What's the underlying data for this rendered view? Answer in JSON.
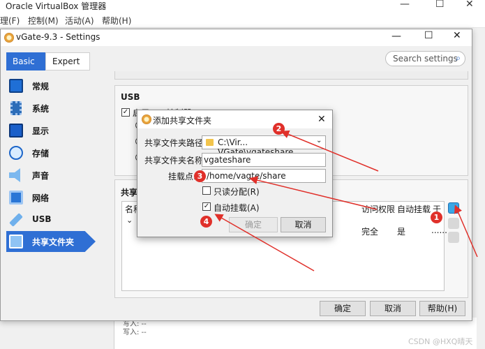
{
  "main_window": {
    "title": "Oracle VirtualBox 管理器",
    "menu": [
      "理(F)",
      "控制(M)",
      "活动(A)",
      "帮助(H)"
    ],
    "bg_fragments": [
      "写入: --",
      "写入: --"
    ]
  },
  "settings": {
    "title": "vGate-9.3 - Settings",
    "search_placeholder": "Search settings",
    "modes": [
      "Basic",
      "Expert"
    ],
    "sidebar": [
      {
        "label": "常规",
        "icon": "monitor-icon"
      },
      {
        "label": "系统",
        "icon": "chip-icon"
      },
      {
        "label": "显示",
        "icon": "display-icon"
      },
      {
        "label": "存储",
        "icon": "disk-icon"
      },
      {
        "label": "声音",
        "icon": "speaker-icon"
      },
      {
        "label": "网络",
        "icon": "network-icon"
      },
      {
        "label": "USB",
        "icon": "usb-icon"
      },
      {
        "label": "共享文件夹",
        "icon": "shared-folder-icon",
        "selected": true
      }
    ],
    "usb": {
      "title": "USB",
      "enable_label": "启用USB控制器"
    },
    "shared_folders": {
      "title": "共享文",
      "columns": [
        "名称",
        "访问权限",
        "自动挂载",
        "于"
      ],
      "row": {
        "access": "完全",
        "automount": "是",
        "at": "......"
      }
    },
    "buttons": {
      "ok": "确定",
      "cancel": "取消",
      "help": "帮助(H)"
    }
  },
  "add_share": {
    "title": "添加共享文件夹",
    "path_label": "共享文件夹路径:",
    "path_value": "C:\\Vir... VGate\\vgateshare",
    "name_label": "共享文件夹名称:",
    "name_value": "vgateshare",
    "mount_label": "挂载点:",
    "mount_value": "/home/vagte/share",
    "readonly_label": "只读分配(R)",
    "readonly_checked": false,
    "automount_label": "自动挂载(A)",
    "automount_checked": true,
    "ok_label": "确定",
    "cancel_label": "取消"
  },
  "annotations": {
    "badges": [
      "1",
      "2",
      "3",
      "4"
    ],
    "color": "#e0302a"
  },
  "watermark": "CSDN @HXQ晴天"
}
